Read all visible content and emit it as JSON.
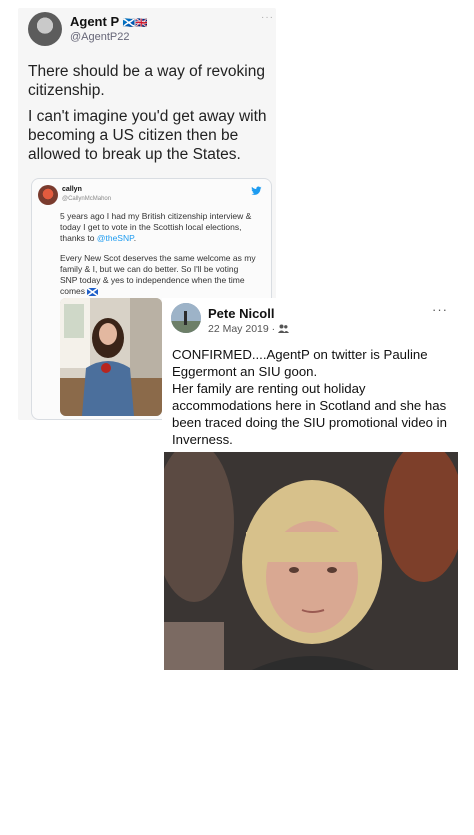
{
  "tweet": {
    "name": "Agent P",
    "flags": "🏴󠁧󠁢󠁳󠁣󠁴󠁿🇬🇧",
    "handle": "@AgentP22",
    "more": "···",
    "line1": "There should be a way of revoking",
    "line2": "citizenship.",
    "line3": "I can't imagine you'd get away with",
    "line4": "becoming a US citizen then be",
    "line5": "allowed to break up the States."
  },
  "quote": {
    "name": "callyn",
    "handle": "@CallynMcMahon",
    "p1_l1": "5 years ago I had my British citizenship interview &",
    "p1_l2": "today I get to vote in the Scottish local elections,",
    "p1_l3_pre": "thanks to ",
    "p1_l3_link": "@theSNP",
    "p1_l3_post": ".",
    "p2_l1": "Every New Scot deserves the same welcome as my",
    "p2_l2": "family & I, but we can do better. So I'll be voting",
    "p2_l3": "SNP today & yes to independence when the time",
    "p2_l4": "comes",
    "colors": {
      "link": "#1d9bf0",
      "bird": "#1d9bf0"
    }
  },
  "fb": {
    "name": "Pete Nicoll",
    "date": "22 May 2019 · ",
    "audience_icon": "friends-icon",
    "more": "···",
    "l1": "CONFIRMED....AgentP on twitter is  Pauline",
    "l2": "Eggermont an  SIU goon.",
    "l3": "Her family are renting out holiday",
    "l4": "accommodations here in Scotland and she has",
    "l5": "been traced doing the SIU promotional video in",
    "l6": "Inverness."
  }
}
